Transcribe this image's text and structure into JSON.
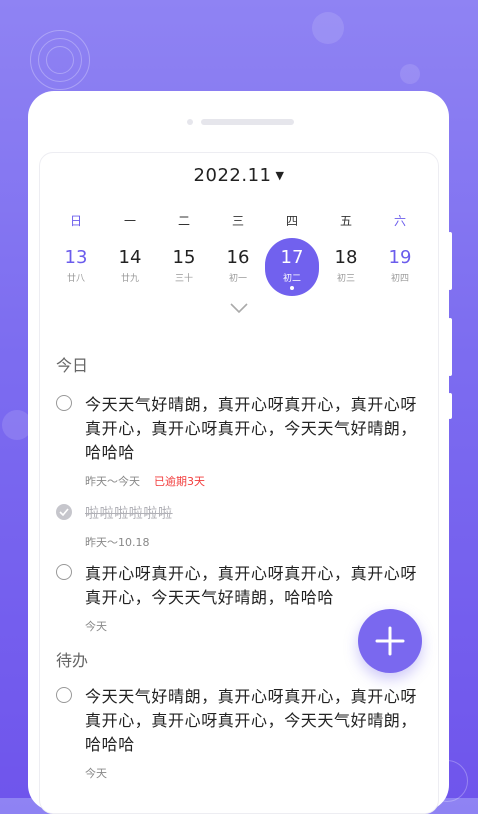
{
  "calendar": {
    "month_label": "2022.11",
    "weekdays": [
      "日",
      "一",
      "二",
      "三",
      "四",
      "五",
      "六"
    ],
    "days": [
      {
        "num": "13",
        "lunar": "廿八"
      },
      {
        "num": "14",
        "lunar": "廿九"
      },
      {
        "num": "15",
        "lunar": "三十"
      },
      {
        "num": "16",
        "lunar": "初一"
      },
      {
        "num": "17",
        "lunar": "初二"
      },
      {
        "num": "18",
        "lunar": "初三"
      },
      {
        "num": "19",
        "lunar": "初四"
      }
    ],
    "selected_day": "17"
  },
  "sections": {
    "today": "今日",
    "pending": "待办"
  },
  "tasks": [
    {
      "text": "今天天气好晴朗，真开心呀真开心，真开心呀真开心，真开心呀真开心，今天天气好晴朗，哈哈哈",
      "date": "昨天～今天",
      "overdue": "已逾期3天",
      "done": false
    },
    {
      "text": "啦啦啦啦啦啦",
      "date": "昨天～10.18",
      "done": true
    },
    {
      "text": "真开心呀真开心，真开心呀真开心，真开心呀真开心，今天天气好晴朗，哈哈哈",
      "date": "今天",
      "done": false
    },
    {
      "text": "今天天气好晴朗，真开心呀真开心，真开心呀真开心，真开心呀真开心，今天天气好晴朗，哈哈哈",
      "date": "今天",
      "done": false
    }
  ],
  "colors": {
    "accent": "#7161ee",
    "overdue": "#f23c3c",
    "background_top": "#8f83f3",
    "background_bottom": "#6f55ec"
  },
  "icons": {
    "month_dropdown": "caret-down-icon",
    "expand": "chevron-down-icon",
    "fab": "plus-icon",
    "done_check": "check-icon"
  }
}
